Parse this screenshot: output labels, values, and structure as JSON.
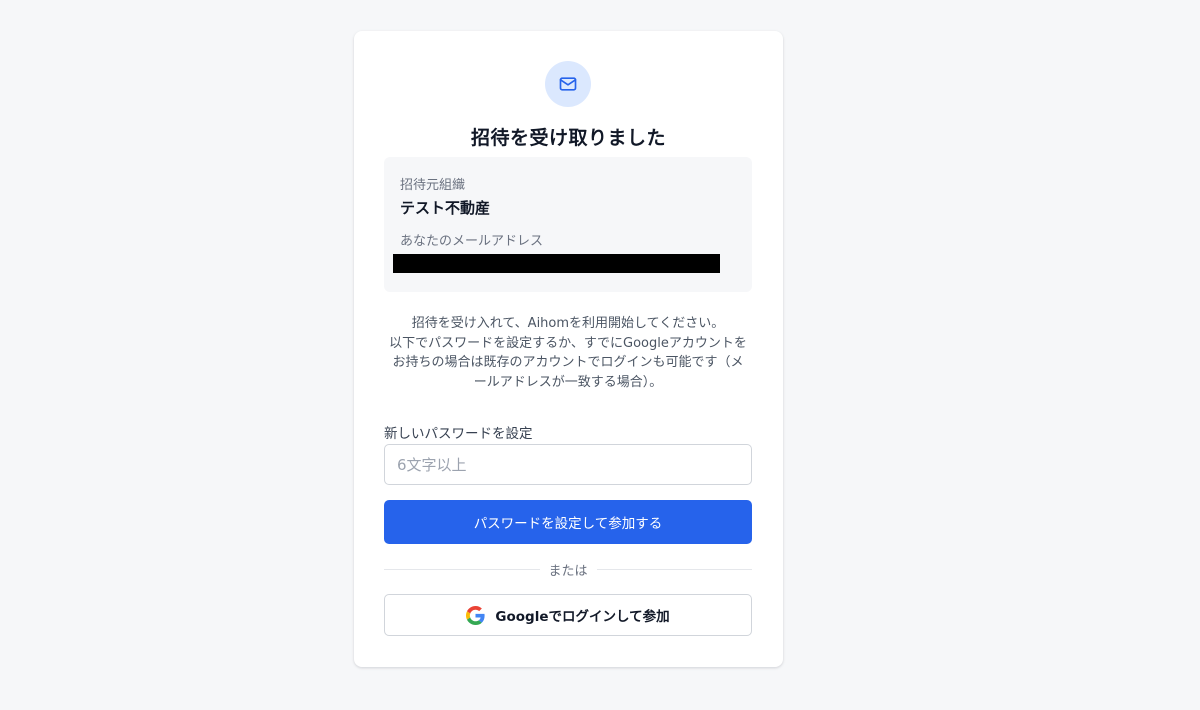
{
  "colors": {
    "page_background": "#f6f7f9",
    "accent": "#2663eb",
    "icon_circle": "#dbe8fe"
  },
  "header": {
    "icon": "mail-icon",
    "title": "招待を受け取りました"
  },
  "invite_info": {
    "org_label": "招待元組織",
    "org_name": "テスト不動産",
    "email_label": "あなたのメールアドレス",
    "email_value": "[redacted]"
  },
  "description": {
    "line1": "招待を受け入れて、Aihomを利用開始してください。",
    "line2": "以下でパスワードを設定するか、すでにGoogleアカウントを",
    "line3": "お持ちの場合は既存のアカウントでログインも可能です（メ",
    "line4": "ールアドレスが一致する場合）。"
  },
  "password_form": {
    "label": "新しいパスワードを設定",
    "placeholder": "6文字以上",
    "value": "",
    "submit_label": "パスワードを設定して参加する"
  },
  "divider_text": "または",
  "google_login": {
    "icon": "google-icon",
    "label": "Googleでログインして参加"
  }
}
